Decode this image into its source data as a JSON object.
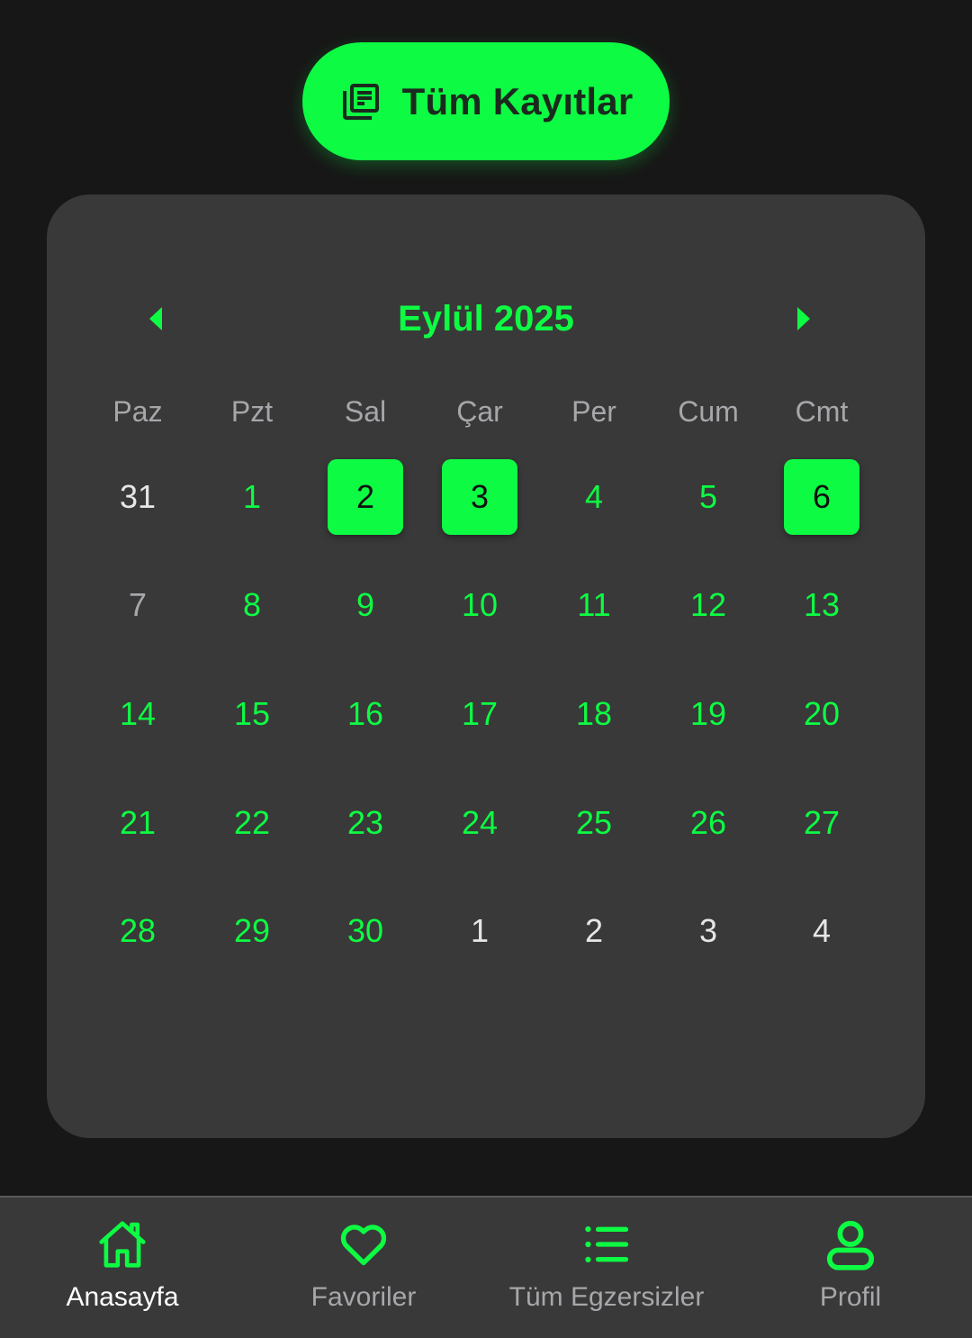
{
  "top_button": {
    "label": "Tüm Kayıtlar",
    "icon": "document-list-icon"
  },
  "calendar": {
    "month_title": "Eylül 2025",
    "prev_icon": "chevron-left-icon",
    "next_icon": "chevron-right-icon",
    "weekdays": [
      "Paz",
      "Pzt",
      "Sal",
      "Çar",
      "Per",
      "Cum",
      "Cmt"
    ],
    "weeks": [
      [
        {
          "label": "31",
          "state": "outside"
        },
        {
          "label": "1",
          "state": "normal"
        },
        {
          "label": "2",
          "state": "marked"
        },
        {
          "label": "3",
          "state": "marked"
        },
        {
          "label": "4",
          "state": "normal"
        },
        {
          "label": "5",
          "state": "normal"
        },
        {
          "label": "6",
          "state": "marked"
        }
      ],
      [
        {
          "label": "7",
          "state": "outside-dim"
        },
        {
          "label": "8",
          "state": "normal"
        },
        {
          "label": "9",
          "state": "normal"
        },
        {
          "label": "10",
          "state": "normal"
        },
        {
          "label": "11",
          "state": "normal"
        },
        {
          "label": "12",
          "state": "normal"
        },
        {
          "label": "13",
          "state": "normal"
        }
      ],
      [
        {
          "label": "14",
          "state": "normal"
        },
        {
          "label": "15",
          "state": "normal"
        },
        {
          "label": "16",
          "state": "normal"
        },
        {
          "label": "17",
          "state": "normal"
        },
        {
          "label": "18",
          "state": "normal"
        },
        {
          "label": "19",
          "state": "normal"
        },
        {
          "label": "20",
          "state": "normal"
        }
      ],
      [
        {
          "label": "21",
          "state": "normal"
        },
        {
          "label": "22",
          "state": "normal"
        },
        {
          "label": "23",
          "state": "normal"
        },
        {
          "label": "24",
          "state": "normal"
        },
        {
          "label": "25",
          "state": "normal"
        },
        {
          "label": "26",
          "state": "normal"
        },
        {
          "label": "27",
          "state": "normal"
        }
      ],
      [
        {
          "label": "28",
          "state": "normal"
        },
        {
          "label": "29",
          "state": "normal"
        },
        {
          "label": "30",
          "state": "normal"
        },
        {
          "label": "1",
          "state": "outside"
        },
        {
          "label": "2",
          "state": "outside"
        },
        {
          "label": "3",
          "state": "outside"
        },
        {
          "label": "4",
          "state": "outside"
        }
      ]
    ]
  },
  "bottom_nav": {
    "items": [
      {
        "label": "Anasayfa",
        "icon": "home-icon",
        "active": true
      },
      {
        "label": "Favoriler",
        "icon": "heart-icon",
        "active": false
      },
      {
        "label": "Tüm Egzersizler",
        "icon": "list-icon",
        "active": false
      },
      {
        "label": "Profil",
        "icon": "user-icon",
        "active": false
      }
    ]
  },
  "colors": {
    "accent": "#0dfc43",
    "background": "#171717",
    "card": "#393939",
    "muted_text": "#a7a7ab"
  }
}
